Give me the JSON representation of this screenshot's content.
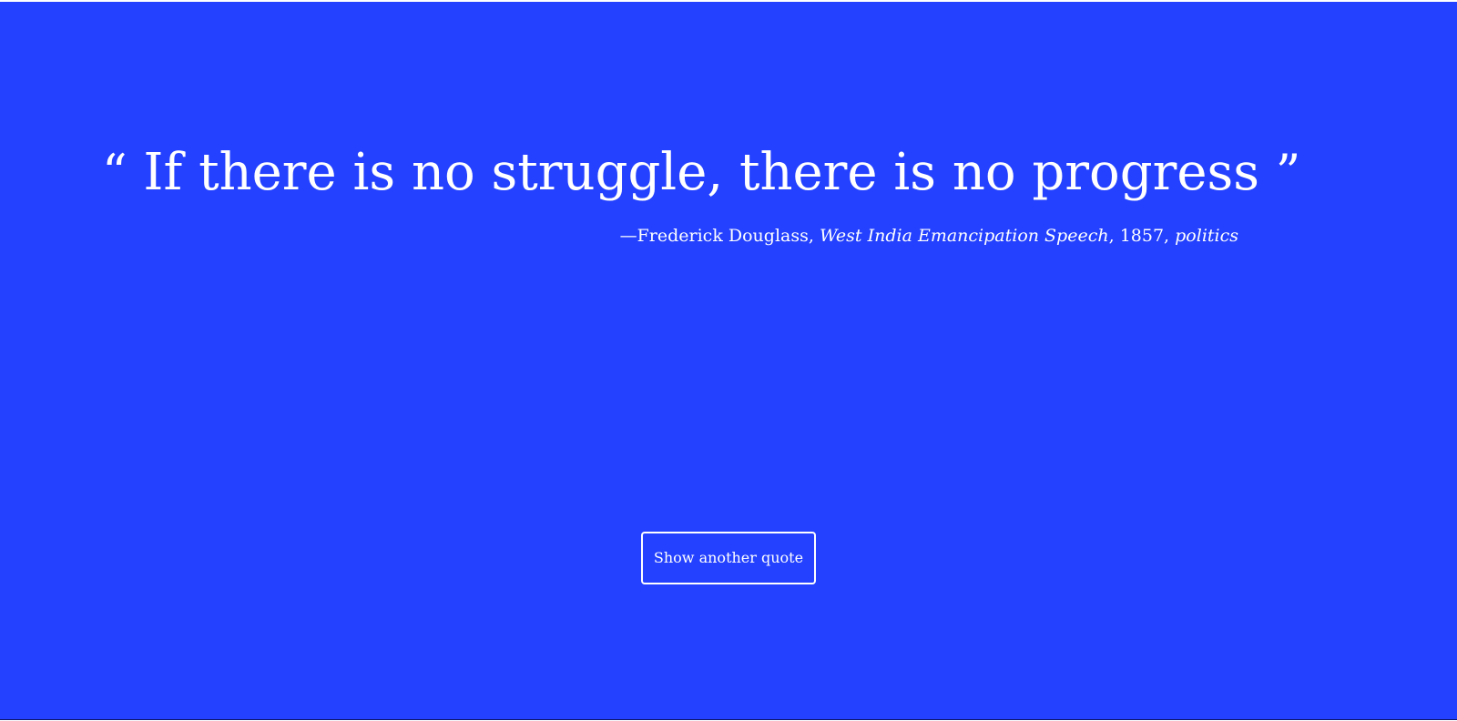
{
  "quote": {
    "open_mark": "“",
    "text": "If there is no struggle, there is no progress",
    "close_mark": "”"
  },
  "attribution": {
    "dash": "—",
    "author": "Frederick Douglass",
    "source": "West India Emancipation Speech",
    "year": "1857",
    "topic": "politics"
  },
  "actions": {
    "another_label": "Show another quote"
  },
  "colors": {
    "background": "#2341ff",
    "text": "#ffffff"
  }
}
